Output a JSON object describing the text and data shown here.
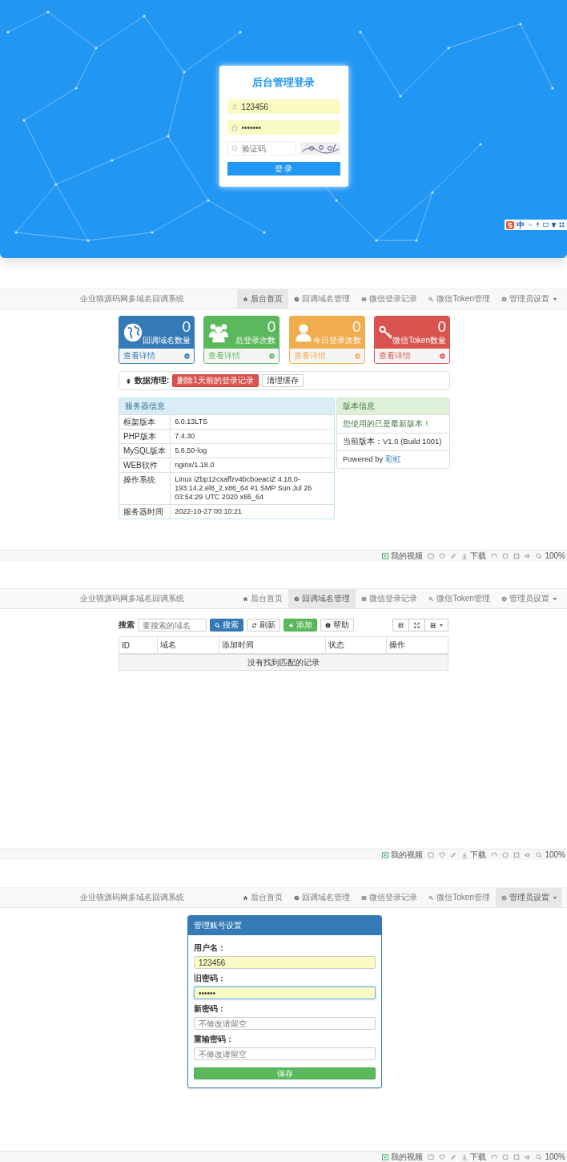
{
  "login": {
    "title": "后台管理登录",
    "username": "123456",
    "password": "•••••••",
    "captcha_placeholder": "验证码",
    "submit": "登 录"
  },
  "ime": {
    "label": "中"
  },
  "screens": [
    {
      "kind": "dashboard",
      "brand": "企业猫源码网多域名回调系统",
      "nav": [
        {
          "label": "后台首页",
          "selected": true,
          "dropdown": false
        },
        {
          "label": "回调域名管理",
          "selected": false,
          "dropdown": false
        },
        {
          "label": "微信登录记录",
          "selected": false,
          "dropdown": false
        },
        {
          "label": "微信Token管理",
          "selected": false,
          "dropdown": false
        },
        {
          "label": "管理员设置",
          "selected": false,
          "dropdown": true
        }
      ],
      "stat_cards": [
        {
          "value": "0",
          "label": "回调域名数量",
          "link": "查看详情",
          "color": "#337ab7"
        },
        {
          "value": "0",
          "label": "总登录次数",
          "link": "查看详情",
          "color": "#5cb85c"
        },
        {
          "value": "0",
          "label": "今日登录次数",
          "link": "查看详情",
          "color": "#f0ad4e"
        },
        {
          "value": "0",
          "label": "微信Token数量",
          "link": "查看详情",
          "color": "#d9534f"
        }
      ],
      "cleanup": {
        "label": "数据清理:",
        "buttons": [
          {
            "label": "删除1天前的登录记录",
            "kind": "danger"
          },
          {
            "label": "清理缓存",
            "kind": "default"
          }
        ]
      },
      "server_info": {
        "title": "服务器信息",
        "rows": [
          {
            "label": "框架版本",
            "value": "6.0.13LTS"
          },
          {
            "label": "PHP版本",
            "value": "7.4.30"
          },
          {
            "label": "MySQL版本",
            "value": "5.6.50-log"
          },
          {
            "label": "WEB软件",
            "value": "nginx/1.18.0"
          },
          {
            "label": "操作系统",
            "value": "Linux iZbp12cxaffzv4bcboeaciZ 4.18.0-193.14.2.el8_2.x86_64 #1 SMP Sun Jul 26 03:54:29 UTC 2020 x86_64"
          },
          {
            "label": "服务器时间",
            "value": "2022-10-27 00:10:21"
          }
        ]
      },
      "version_info": {
        "title": "版本信息",
        "message": "您使用的已是最新版本！",
        "version": "当前版本：V1.0 (Build 1001)",
        "powered": "Powered by ",
        "link": "彩虹"
      },
      "status_bar": {
        "video": "我的视频",
        "download": "下载",
        "zoom": "100%"
      }
    },
    {
      "kind": "domains",
      "brand": "企业猫源码网多域名回调系统",
      "nav": [
        {
          "label": "后台首页",
          "selected": false,
          "dropdown": false
        },
        {
          "label": "回调域名管理",
          "selected": true,
          "dropdown": false
        },
        {
          "label": "微信登录记录",
          "selected": false,
          "dropdown": false
        },
        {
          "label": "微信Token管理",
          "selected": false,
          "dropdown": false
        },
        {
          "label": "管理员设置",
          "selected": false,
          "dropdown": true
        }
      ],
      "search_label": "搜索",
      "search_placeholder": "要搜索的域名",
      "buttons": [
        {
          "label": "搜索",
          "kind": "primary"
        },
        {
          "label": "刷新",
          "kind": "default"
        },
        {
          "label": "添加",
          "kind": "success"
        },
        {
          "label": "帮助",
          "kind": "default"
        }
      ],
      "columns": [
        "ID",
        "域名",
        "添加时间",
        "状态",
        "操作"
      ],
      "empty": "没有找到匹配的记录",
      "status_bar": {
        "video": "我的视频",
        "download": "下载",
        "zoom": "100%"
      }
    },
    {
      "kind": "account",
      "brand": "企业猫源码网多域名回调系统",
      "nav": [
        {
          "label": "后台首页",
          "selected": false,
          "dropdown": false
        },
        {
          "label": "回调域名管理",
          "selected": false,
          "dropdown": false
        },
        {
          "label": "微信登录记录",
          "selected": false,
          "dropdown": false
        },
        {
          "label": "微信Token管理",
          "selected": false,
          "dropdown": false
        },
        {
          "label": "管理员设置",
          "selected": true,
          "dropdown": true
        }
      ],
      "title": "管理账号设置",
      "fields": [
        {
          "label": "用户名：",
          "value": "123456",
          "focused": false
        },
        {
          "label": "旧密码：",
          "value": "••••••",
          "focused": true
        },
        {
          "label": "新密码：",
          "placeholder": "不修改请留空",
          "focused": false
        },
        {
          "label": "重输密码：",
          "placeholder": "不修改请留空",
          "focused": false
        }
      ],
      "submit": "保存",
      "status_bar": {
        "video": "我的视频",
        "download": "下载",
        "zoom": "100%"
      }
    }
  ]
}
